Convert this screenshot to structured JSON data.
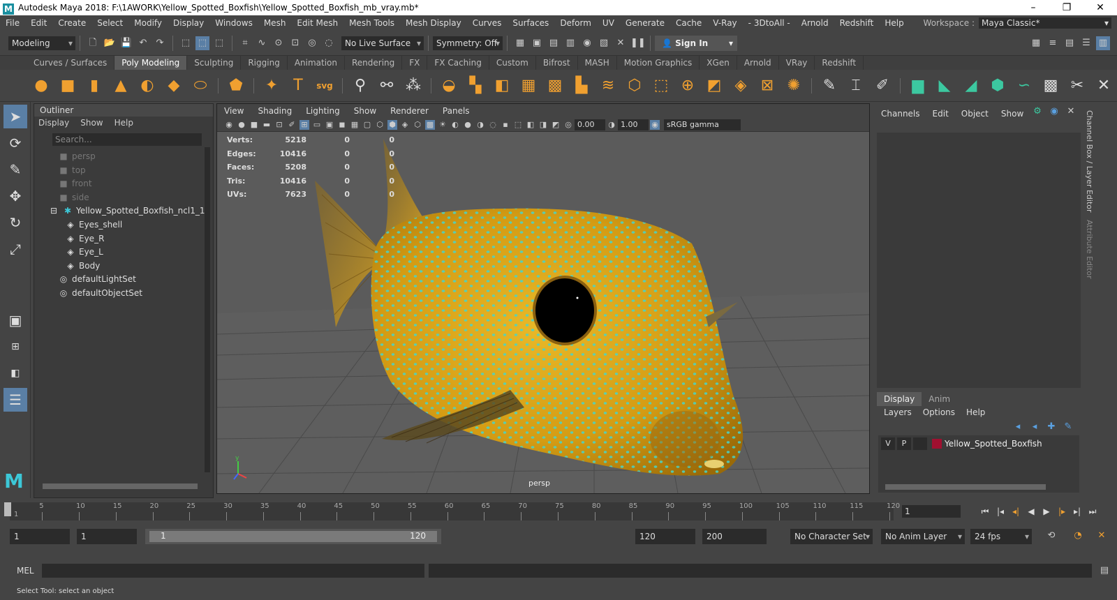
{
  "window": {
    "title": "Autodesk Maya 2018: F:\\1AWORK\\Yellow_Spotted_Boxfish\\Yellow_Spotted_Boxfish_mb_vray.mb*",
    "logo": "M"
  },
  "menubar": {
    "items": [
      "File",
      "Edit",
      "Create",
      "Select",
      "Modify",
      "Display",
      "Windows",
      "Mesh",
      "Edit Mesh",
      "Mesh Tools",
      "Mesh Display",
      "Curves",
      "Surfaces",
      "Deform",
      "UV",
      "Generate",
      "Cache",
      "V-Ray",
      "- 3DtoAll -",
      "Arnold",
      "Redshift",
      "Help"
    ],
    "workspace_label": "Workspace :",
    "workspace_value": "Maya Classic*"
  },
  "statusline": {
    "mode": "Modeling",
    "live_surface": "No Live Surface",
    "symmetry": "Symmetry: Off",
    "sign_in": "Sign In"
  },
  "shelf": {
    "tabs": [
      "Curves / Surfaces",
      "Poly Modeling",
      "Sculpting",
      "Rigging",
      "Animation",
      "Rendering",
      "FX",
      "FX Caching",
      "Custom",
      "Bifrost",
      "MASH",
      "Motion Graphics",
      "XGen",
      "Arnold",
      "VRay",
      "Redshift"
    ],
    "active_tab": "Poly Modeling",
    "svg_label": "svg",
    "text_label": "T"
  },
  "outliner": {
    "title": "Outliner",
    "menu": [
      "Display",
      "Show",
      "Help"
    ],
    "search_placeholder": "Search...",
    "items": [
      {
        "label": "persp",
        "dim": true
      },
      {
        "label": "top",
        "dim": true
      },
      {
        "label": "front",
        "dim": true
      },
      {
        "label": "side",
        "dim": true
      },
      {
        "label": "Yellow_Spotted_Boxfish_ncl1_1"
      },
      {
        "label": "Eyes_shell"
      },
      {
        "label": "Eye_R"
      },
      {
        "label": "Eye_L"
      },
      {
        "label": "Body"
      },
      {
        "label": "defaultLightSet"
      },
      {
        "label": "defaultObjectSet"
      }
    ]
  },
  "viewport": {
    "menu": [
      "View",
      "Shading",
      "Lighting",
      "Show",
      "Renderer",
      "Panels"
    ],
    "exposure": "0.00",
    "gamma": "1.00",
    "color_space": "sRGB gamma",
    "camera_label": "persp",
    "hud": [
      {
        "k": "Verts:",
        "a": "5218",
        "b": "0",
        "c": "0"
      },
      {
        "k": "Edges:",
        "a": "10416",
        "b": "0",
        "c": "0"
      },
      {
        "k": "Faces:",
        "a": "5208",
        "b": "0",
        "c": "0"
      },
      {
        "k": "Tris:",
        "a": "10416",
        "b": "0",
        "c": "0"
      },
      {
        "k": "UVs:",
        "a": "7623",
        "b": "0",
        "c": "0"
      }
    ],
    "axis_y": "y",
    "axis_x": "x"
  },
  "channelbox": {
    "menu": [
      "Channels",
      "Edit",
      "Object",
      "Show"
    ],
    "side_tab_1": "Channel Box / Layer Editor",
    "side_tab_2": "Attribute Editor"
  },
  "layereditor": {
    "tabs": [
      "Display",
      "Anim"
    ],
    "menu": [
      "Layers",
      "Options",
      "Help"
    ],
    "layer": {
      "v": "V",
      "p": "P",
      "name": "Yellow_Spotted_Boxfish",
      "color": "#a01030"
    }
  },
  "timeline": {
    "ticks": [
      "5",
      "10",
      "15",
      "20",
      "25",
      "30",
      "35",
      "40",
      "45",
      "50",
      "55",
      "60",
      "65",
      "70",
      "75",
      "80",
      "85",
      "90",
      "95",
      "100",
      "105",
      "110",
      "115",
      "120"
    ],
    "start_tick": "1",
    "current_frame": "1",
    "start": 1,
    "end": 120
  },
  "range": {
    "start": "1",
    "playback_start": "1",
    "slider_start": "1",
    "slider_end": "120",
    "playback_end": "120",
    "end": "200",
    "character_set": "No Character Set",
    "anim_layer": "No Anim Layer",
    "fps": "24 fps"
  },
  "commandline": {
    "label": "MEL",
    "help": "Select Tool: select an object"
  },
  "colors": {
    "fish_body": "#d8a418",
    "fish_spots": "#48d4c8",
    "accent": "#5a7fa5"
  }
}
